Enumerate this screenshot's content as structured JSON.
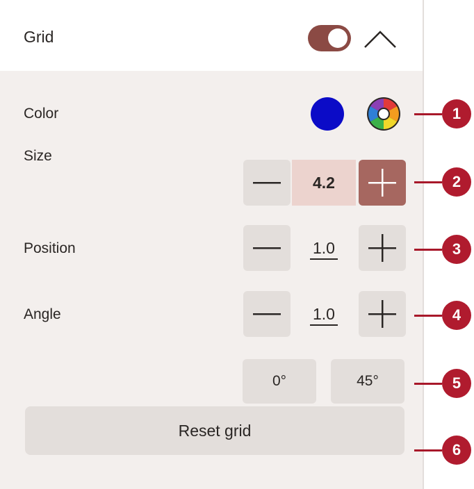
{
  "header": {
    "title": "Grid",
    "toggle_on": true,
    "collapse_icon": "chevron-up-icon"
  },
  "color": {
    "label": "Color",
    "swatch": "#0b0bc7",
    "picker_icon": "color-wheel-icon"
  },
  "size": {
    "label": "Size",
    "value": "4.2"
  },
  "position": {
    "label": "Position",
    "value": "1.0"
  },
  "angle": {
    "label": "Angle",
    "value": "1.0",
    "preset_0": "0°",
    "preset_45": "45°"
  },
  "reset": {
    "label": "Reset grid"
  },
  "callouts": [
    "1",
    "2",
    "3",
    "4",
    "5",
    "6"
  ],
  "colors": {
    "accent": "#8b4a44",
    "callout": "#b01b2e",
    "panel": "#f3efed",
    "button": "#e3dedb"
  }
}
